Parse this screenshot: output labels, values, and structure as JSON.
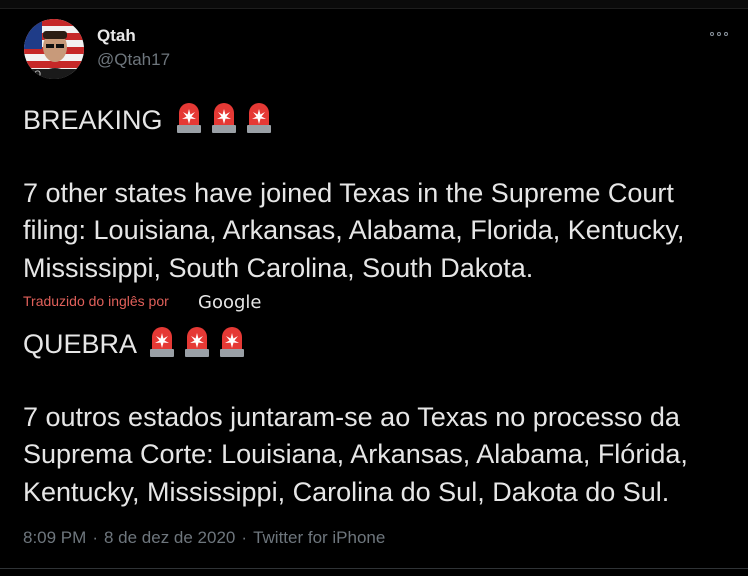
{
  "tweet": {
    "display_name": "Qtah",
    "handle": "@Qtah17",
    "original": {
      "heading": "BREAKING",
      "line1": "7 other states have joined Texas in the Supreme Court",
      "line2": "filing: Louisiana, Arkansas, Alabama, Florida, Kentucky,",
      "line3": "Mississippi, South Carolina, South Dakota."
    },
    "translation_note": "Traduzido do inglês por",
    "translation_provider": "Google",
    "translated": {
      "heading": "QUEBRA",
      "line1": " 7 outros estados juntaram-se ao Texas no processo da",
      "line2": "Suprema Corte: Louisiana, Arkansas, Alabama, Flórida,",
      "line3": "Kentucky, Mississippi, Carolina do Sul, Dakota do Sul."
    },
    "time": "8:09 PM",
    "date": "8 de dez de 2020",
    "source": "Twitter for iPhone",
    "emoji": "police-car-light-emoji",
    "colors": {
      "background": "#000000",
      "muted": "#6e767d",
      "translation_note": "#e0605a"
    }
  }
}
